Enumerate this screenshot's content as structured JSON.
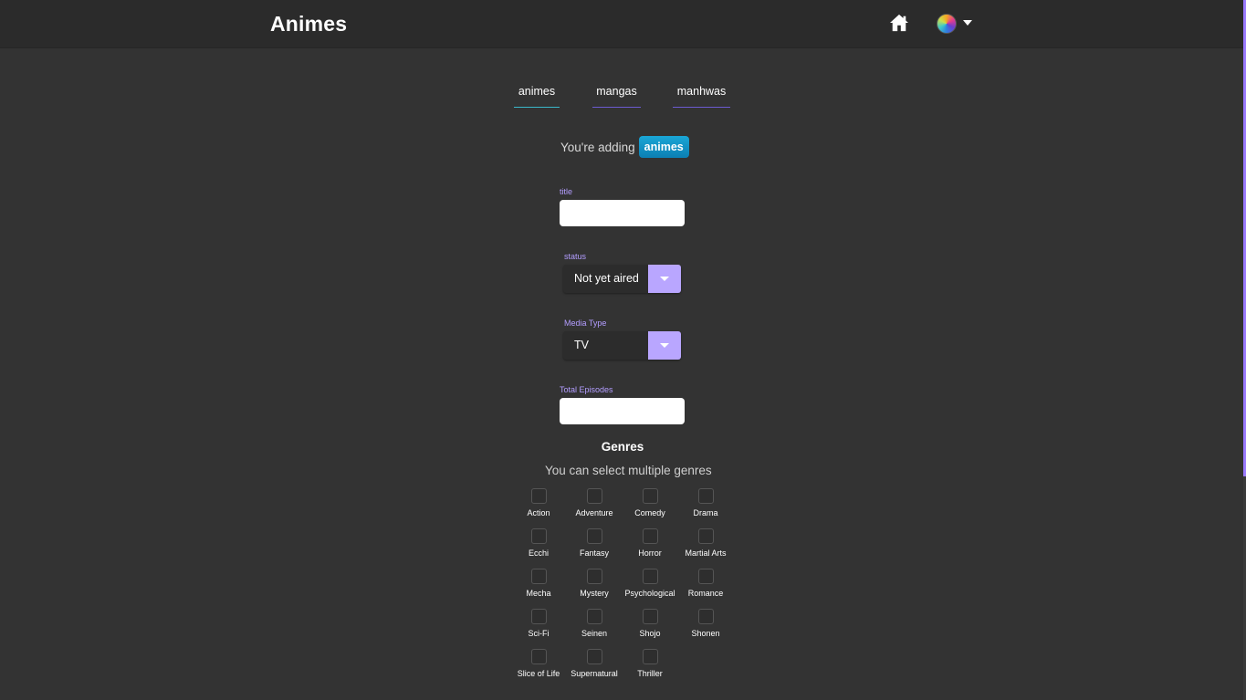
{
  "app": {
    "title": "Animes"
  },
  "header": {
    "home_icon": "home-icon",
    "avatar_icon": "avatar-menu"
  },
  "tabs": [
    {
      "label": "animes",
      "active": true
    },
    {
      "label": "mangas",
      "active": false
    },
    {
      "label": "manhwas",
      "active": false
    }
  ],
  "adding": {
    "prefix": "You're adding",
    "badge": "animes"
  },
  "form": {
    "title": {
      "label": "title",
      "value": ""
    },
    "status": {
      "label": "status",
      "value": "Not yet aired"
    },
    "media_type": {
      "label": "Media Type",
      "value": "TV"
    },
    "total_episodes": {
      "label": "Total Episodes",
      "value": ""
    }
  },
  "genres": {
    "title": "Genres",
    "subtitle": "You can select multiple genres",
    "items": [
      "Action",
      "Adventure",
      "Comedy",
      "Drama",
      "Ecchi",
      "Fantasy",
      "Horror",
      "Martial Arts",
      "Mecha",
      "Mystery",
      "Psychological",
      "Romance",
      "Sci-Fi",
      "Seinen",
      "Shojo",
      "Shonen",
      "Slice of Life",
      "Supernatural",
      "Thriller"
    ]
  },
  "colors": {
    "background": "#333333",
    "topbar": "#2b2b2b",
    "accent_purple": "#b9a6ff",
    "badge_blue": "#1aa6d6",
    "tab_active_underline": "#3ab7c9",
    "tab_underline": "#6c5bd0"
  }
}
